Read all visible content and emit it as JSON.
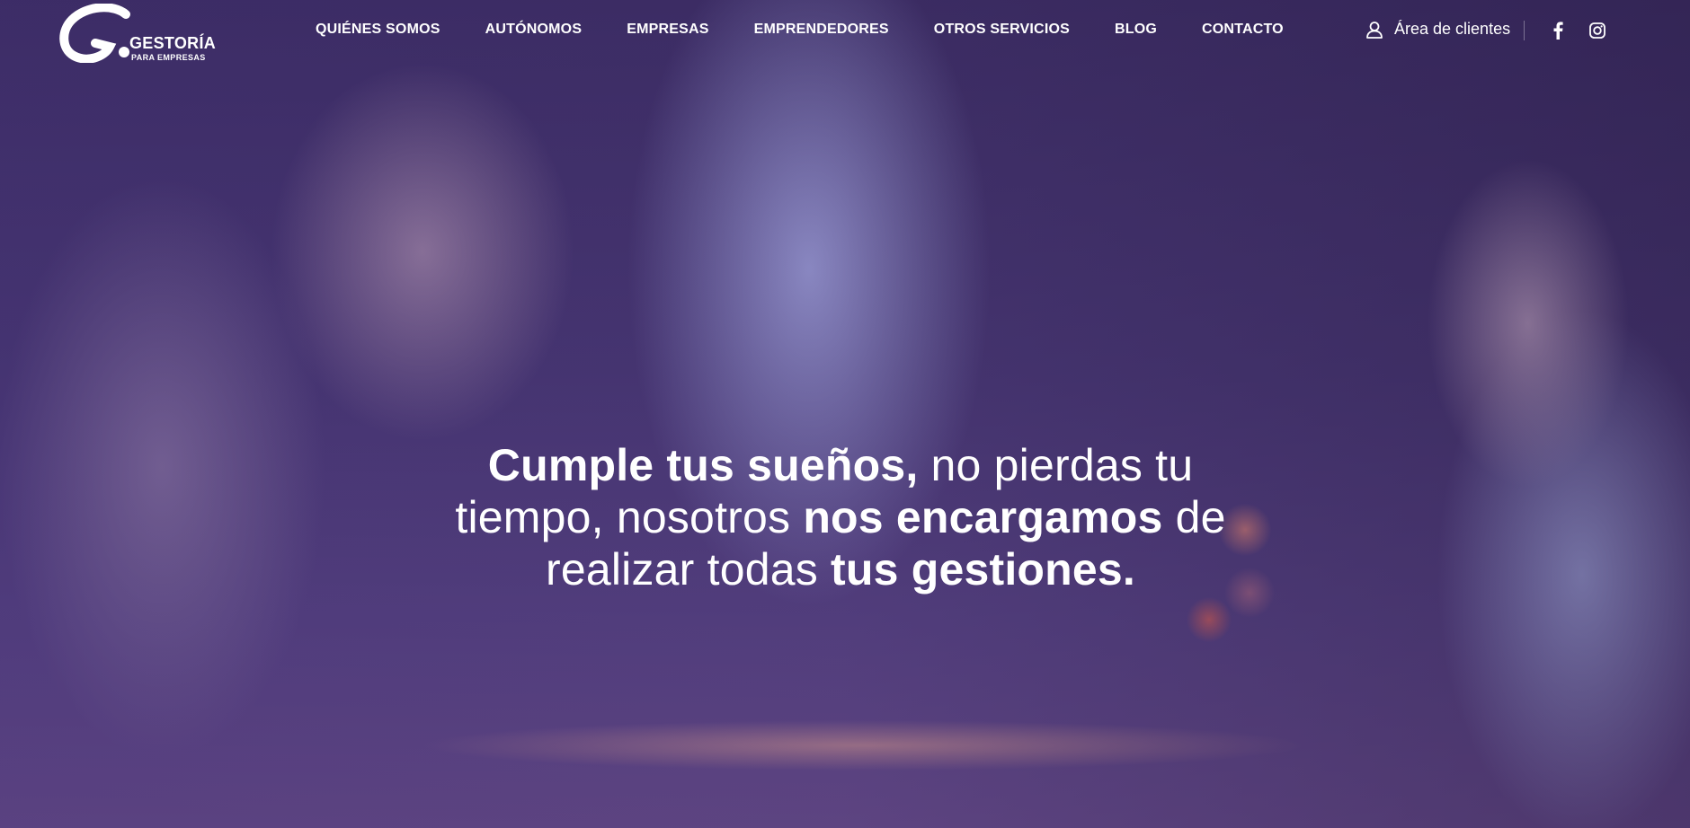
{
  "brand": {
    "logo_line1": "GESTORÍA",
    "logo_line2": "PARA EMPRESAS",
    "logo_mark": "G"
  },
  "nav": {
    "items": [
      {
        "label": "QUIÉNES SOMOS"
      },
      {
        "label": "AUTÓNOMOS"
      },
      {
        "label": "EMPRESAS"
      },
      {
        "label": "EMPRENDEDORES"
      },
      {
        "label": "OTROS SERVICIOS"
      },
      {
        "label": "BLOG"
      },
      {
        "label": "CONTACTO"
      }
    ]
  },
  "header_right": {
    "clients_label": "Área de clientes",
    "clients_icon": "user-icon",
    "social": [
      {
        "icon": "facebook-icon"
      },
      {
        "icon": "instagram-icon"
      }
    ]
  },
  "hero": {
    "headline_parts": [
      {
        "text": "Cumple tus sueños,",
        "bold": true
      },
      {
        "text": " no pierdas tu tiempo, nosotros ",
        "bold": false
      },
      {
        "text": "nos encargamos",
        "bold": true
      },
      {
        "text": " de realizar todas ",
        "bold": false
      },
      {
        "text": "tus gestiones.",
        "bold": true
      }
    ]
  },
  "colors": {
    "overlay": "#4b3f7a",
    "text": "#ffffff"
  }
}
